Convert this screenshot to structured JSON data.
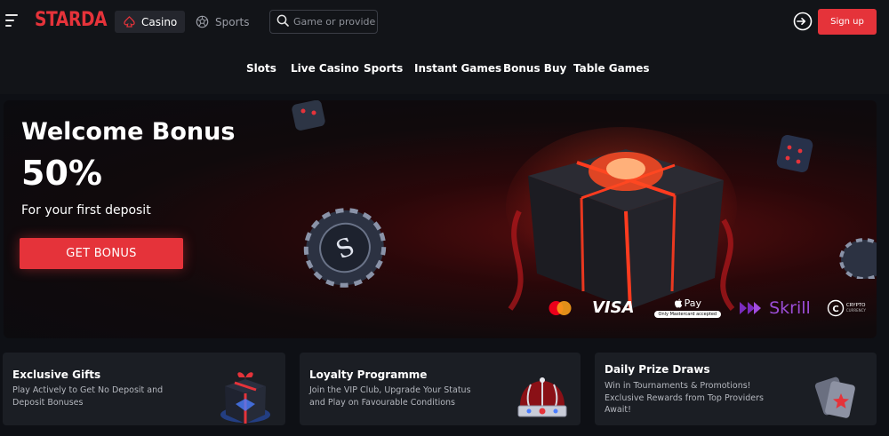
{
  "header": {
    "logo": "STARDA",
    "tabs": [
      {
        "label": "Casino",
        "icon": "spade-icon",
        "active": true
      },
      {
        "label": "Sports",
        "icon": "football-icon",
        "active": false
      }
    ],
    "search": {
      "placeholder": "Game or provider",
      "value": ""
    },
    "signup_label": "Sign up"
  },
  "subnav": {
    "items": [
      "Slots",
      "Live Casino",
      "Sports",
      "Instant Games",
      "Bonus Buy",
      "Table Games"
    ]
  },
  "banner": {
    "title": "Welcome Bonus",
    "percent": "50%",
    "subtitle": "For your first deposit",
    "button_label": "GET BONUS",
    "chip_letter": "S",
    "payments": {
      "visa": "VISA",
      "apple_pay": "Pay",
      "apple_pay_note": "Only Mastercard accepted",
      "skrill": "Skrill",
      "crypto_line1": "CRYPTO",
      "crypto_line2": "CURRENCY"
    }
  },
  "cards": [
    {
      "title": "Exclusive Gifts",
      "text": "Play Actively to Get No Deposit and Deposit Bonuses",
      "icon": "gift-icon"
    },
    {
      "title": "Loyalty Programme",
      "text": "Join the VIP Club, Upgrade Your Status and Play on Favourable Conditions",
      "icon": "crown-icon"
    },
    {
      "title": "Daily Prize Draws",
      "text": "Win in Tournaments & Promotions! Exclusive Rewards from Top Providers Await!",
      "icon": "cards-icon"
    }
  ],
  "colors": {
    "accent": "#e5333a",
    "background": "#0e1015",
    "card": "#1b1e24",
    "skrill": "#7b2cbf"
  }
}
